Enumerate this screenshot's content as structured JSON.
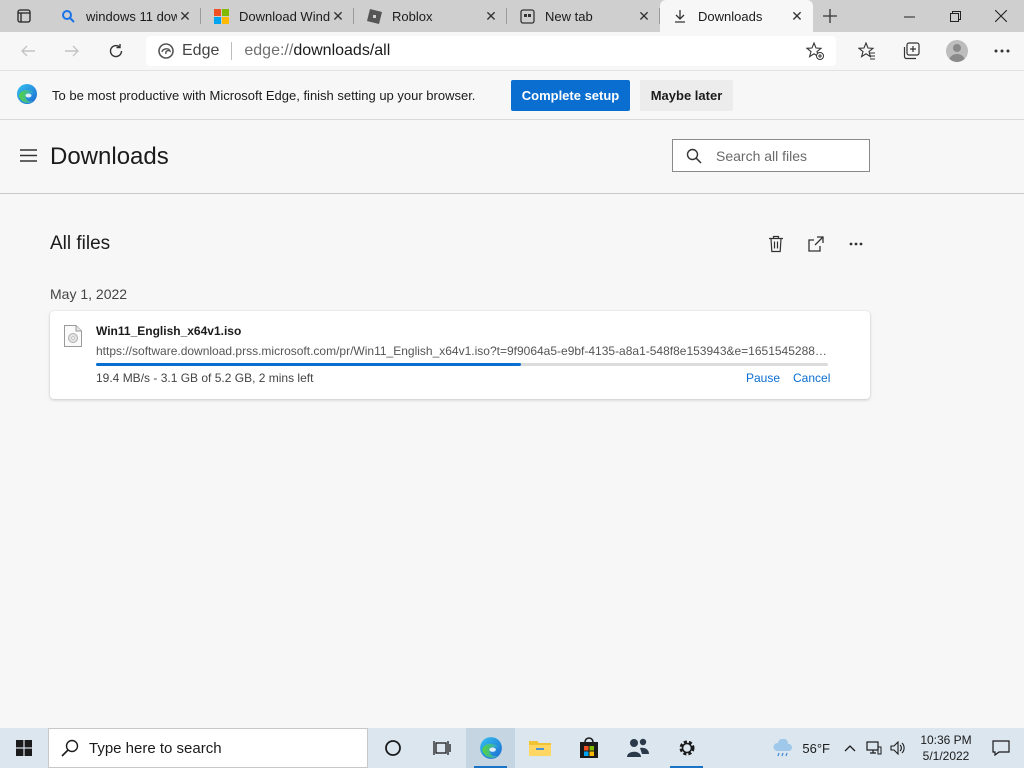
{
  "tabs": [
    {
      "title": "windows 11 dow",
      "icon": "search-icon",
      "active": false
    },
    {
      "title": "Download Wind",
      "icon": "microsoft-logo-icon",
      "active": false
    },
    {
      "title": "Roblox",
      "icon": "roblox-icon",
      "active": false
    },
    {
      "title": "New tab",
      "icon": "newtab-icon",
      "active": false
    },
    {
      "title": "Downloads",
      "icon": "download-icon",
      "active": true
    }
  ],
  "address": {
    "brand": "Edge",
    "url_scheme": "edge://",
    "url_path": "downloads/all"
  },
  "infobar": {
    "message": "To be most productive with Microsoft Edge, finish setting up your browser.",
    "primary": "Complete setup",
    "secondary": "Maybe later"
  },
  "page": {
    "title": "Downloads",
    "search_placeholder": "Search all files",
    "section_title": "All files",
    "date": "May 1, 2022"
  },
  "download": {
    "file_name": "Win11_English_x64v1.iso",
    "url": "https://software.download.prss.microsoft.com/pr/Win11_English_x64v1.iso?t=9f9064a5-e9bf-4135-a8a1-548f8e153943&e=1651545288&...",
    "status": "19.4 MB/s - 3.1 GB of 5.2 GB, 2 mins left",
    "progress": 0.58,
    "pause_label": "Pause",
    "cancel_label": "Cancel"
  },
  "taskbar": {
    "search_text": "Type here to search",
    "temperature": "56°F",
    "time": "10:36 PM",
    "date": "5/1/2022"
  },
  "colors": {
    "accent": "#0a6ed1",
    "taskbar": "#dbe6ef"
  }
}
